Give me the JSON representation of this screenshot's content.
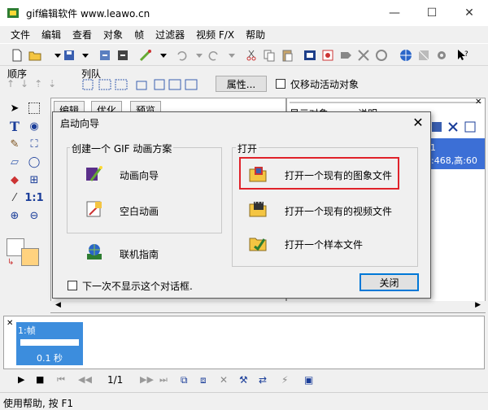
{
  "window": {
    "title": "gif编辑软件 www.leawo.cn",
    "minimize": "—",
    "maximize": "☐",
    "close": "✕"
  },
  "menu": [
    "文件",
    "编辑",
    "查看",
    "对象",
    "帧",
    "过滤器",
    "视频 F/X",
    "帮助"
  ],
  "toolbar2": {
    "order_label": "顺序",
    "align_label": "列队",
    "properties_button": "属性...",
    "only_move_active_label": "仅移动活动对象"
  },
  "editor_tabs": [
    "编辑",
    "优化",
    "预览"
  ],
  "object_panel": {
    "col_object": "显示对象",
    "col_desc": "说明",
    "selected_index": "1",
    "selected_desc": "宽:468,高:60"
  },
  "frames": {
    "frame_label": "1:帧",
    "frame_time": "0.1 秒"
  },
  "playback": {
    "frame_counter": "1/1"
  },
  "status_text": "使用帮助, 按 F1",
  "dialog": {
    "title": "启动向导",
    "create_group": "创建一个 GIF 动画方案",
    "wizard": "动画向导",
    "blank": "空白动画",
    "online_guide": "联机指南",
    "open_group": "打开",
    "open_image": "打开一个现有的图象文件",
    "open_video": "打开一个现有的视频文件",
    "open_sample": "打开一个样本文件",
    "dont_show_again": "下一次不显示这个对话框.",
    "close_button": "关闭"
  },
  "colors": {
    "highlight_border": "#e0222a",
    "selection_blue": "#3c6fd6",
    "frame_blue": "#3c8ddd",
    "swatch_fg": "#ffffff",
    "swatch_bg": "#ffd27f"
  }
}
